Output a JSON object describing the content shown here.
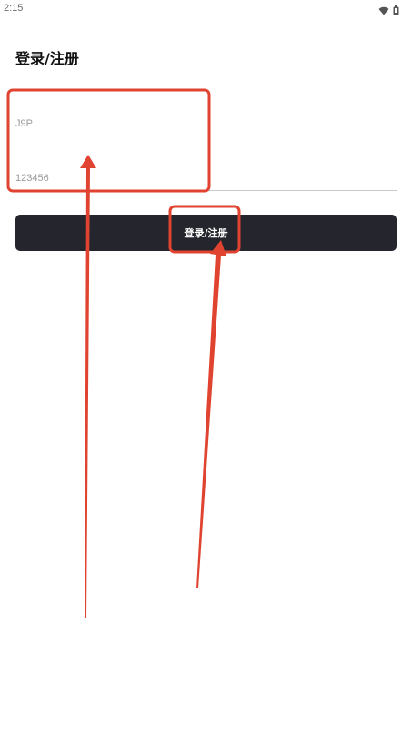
{
  "status_bar": {
    "time": "2:15",
    "icons": [
      "wifi-icon",
      "battery-icon"
    ]
  },
  "page": {
    "title": "登录/注册"
  },
  "form": {
    "username_placeholder": "J9P",
    "password_placeholder": "123456",
    "submit_label": "登录/注册"
  },
  "colors": {
    "button_bg": "#25252d",
    "annotation": "#e0432f"
  }
}
